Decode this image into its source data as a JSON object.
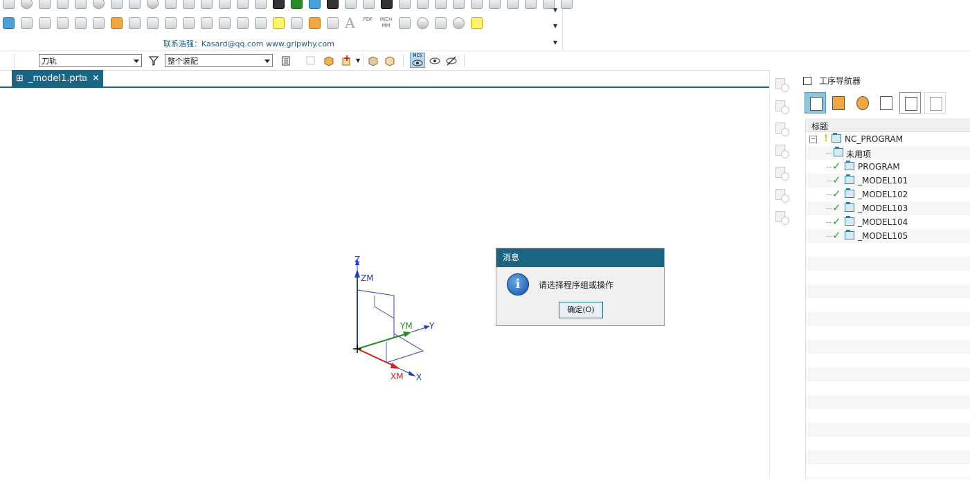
{
  "toolbar": {
    "contact_text": "联系浩强：Kasard@qq.com  www.gripwhy.com",
    "row1_icons": [
      "tool-icon",
      "tool-icon",
      "tool-icon",
      "tool-icon",
      "tool-icon",
      "tool-icon",
      "tool-icon",
      "tool-icon",
      "tool-icon",
      "tool-icon",
      "tool-icon",
      "tool-icon",
      "tool-icon",
      "tool-icon",
      "tool-icon",
      "tool-icon",
      "tool-icon",
      "tool-icon",
      "tool-icon",
      "tool-icon",
      "tool-icon",
      "tool-icon",
      "tool-icon",
      "tool-icon",
      "tool-icon",
      "tool-icon",
      "tool-icon",
      "tool-icon",
      "tool-icon",
      "tool-icon",
      "tool-icon",
      "tool-icon"
    ],
    "row2_text_icons": {
      "font_a": "A",
      "pdf": "PDF",
      "inch_mm": "INCH MM"
    }
  },
  "filterbar": {
    "type_filter": "刀轨",
    "scope_filter": "整个装配",
    "mcs_label": "MCS"
  },
  "tab": {
    "label": "_model1.prt",
    "close": "✕"
  },
  "canvas": {
    "axes": {
      "z": "Z",
      "zm": "ZM",
      "y": "Y",
      "ym": "YM",
      "x": "X",
      "xm": "XM"
    }
  },
  "dialog": {
    "title": "消息",
    "message": "请选择程序组或操作",
    "ok_label": "确定(O)",
    "icon": "info-icon"
  },
  "navigator": {
    "title": "工序导航器",
    "column_header": "标题",
    "tree": [
      {
        "label": "NC_PROGRAM",
        "level": 0,
        "check": false,
        "warning": true
      },
      {
        "label": "未用项",
        "level": 1,
        "check": false
      },
      {
        "label": "PROGRAM",
        "level": 1,
        "check": true
      },
      {
        "label": "_MODEL101",
        "level": 1,
        "check": true
      },
      {
        "label": "_MODEL102",
        "level": 1,
        "check": true
      },
      {
        "label": "_MODEL103",
        "level": 1,
        "check": true
      },
      {
        "label": "_MODEL104",
        "level": 1,
        "check": true
      },
      {
        "label": "_MODEL105",
        "level": 1,
        "check": true
      }
    ],
    "check_glyph": "✓",
    "warning_glyph": "!",
    "expander_glyph": "−"
  },
  "colors": {
    "accent": "#1a6584",
    "check": "#2e9c2e",
    "axis_x": "#cc2222",
    "axis_y": "#2a8a2a",
    "axis_z": "#1f3fbf"
  }
}
